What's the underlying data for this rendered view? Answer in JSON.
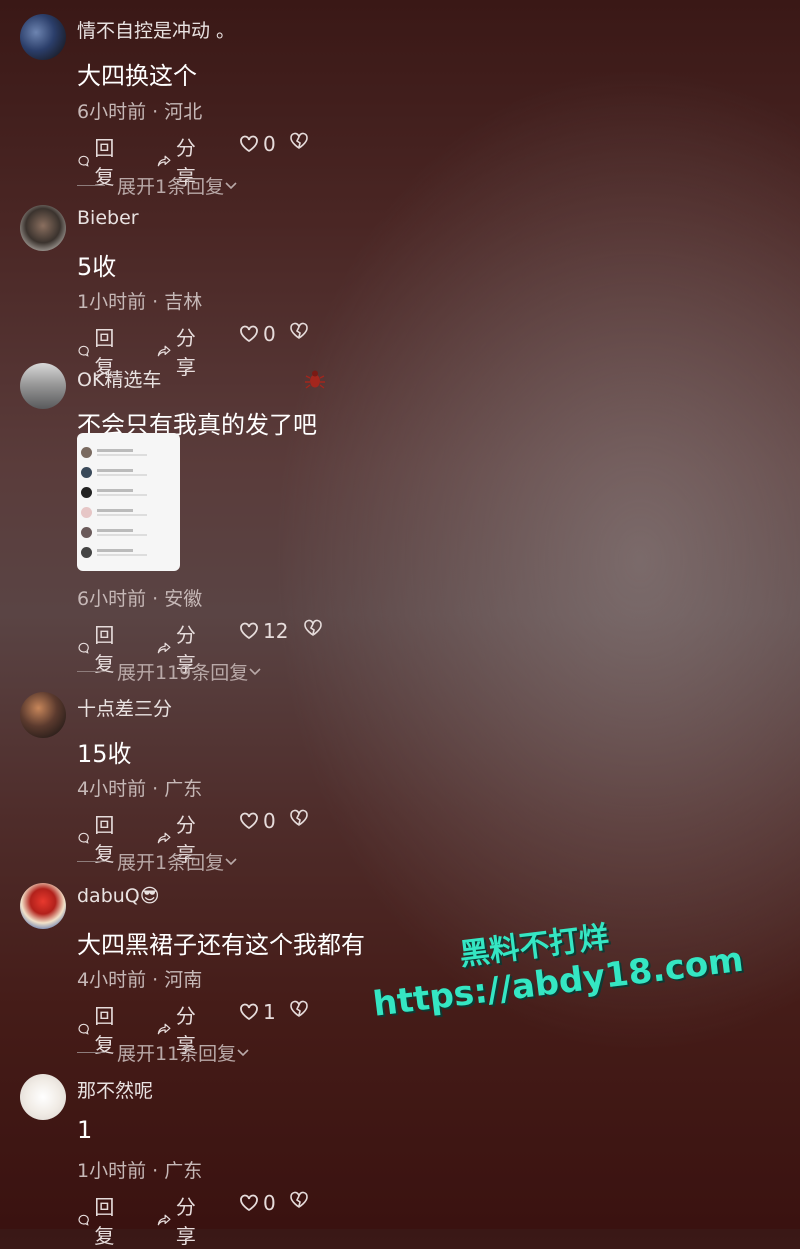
{
  "comments": [
    {
      "username": "情不自控是冲动 。",
      "text": "大四换这个",
      "meta": "6小时前 · 河北",
      "reply": "回复",
      "share": "分享",
      "likes": "0",
      "expand": "展开1条回复"
    },
    {
      "username": "Bieber",
      "text": "5收",
      "meta": "1小时前 · 吉林",
      "reply": "回复",
      "share": "分享",
      "likes": "0"
    },
    {
      "username": "OK精选车",
      "text": "不会只有我真的发了吧",
      "meta": "6小时前 · 安徽",
      "reply": "回复",
      "share": "分享",
      "likes": "12",
      "expand": "展开119条回复"
    },
    {
      "username": "十点差三分",
      "text": "15收",
      "meta": "4小时前 · 广东",
      "reply": "回复",
      "share": "分享",
      "likes": "0",
      "expand": "展开1条回复"
    },
    {
      "username": "dabuQ😎",
      "text": "大四黑裙子还有这个我都有",
      "meta": "4小时前 · 河南",
      "reply": "回复",
      "share": "分享",
      "likes": "1",
      "expand": "展开11条回复"
    },
    {
      "username": "那不然呢",
      "text": "1",
      "meta": "1小时前 · 广东",
      "reply": "回复",
      "share": "分享",
      "likes": "0"
    }
  ],
  "watermark": {
    "line1": "黑料不打烊",
    "line2": "https://abdy18.com"
  },
  "colors": {
    "watermark": "#35e6c3",
    "meta_text": "#c6b8b7"
  }
}
